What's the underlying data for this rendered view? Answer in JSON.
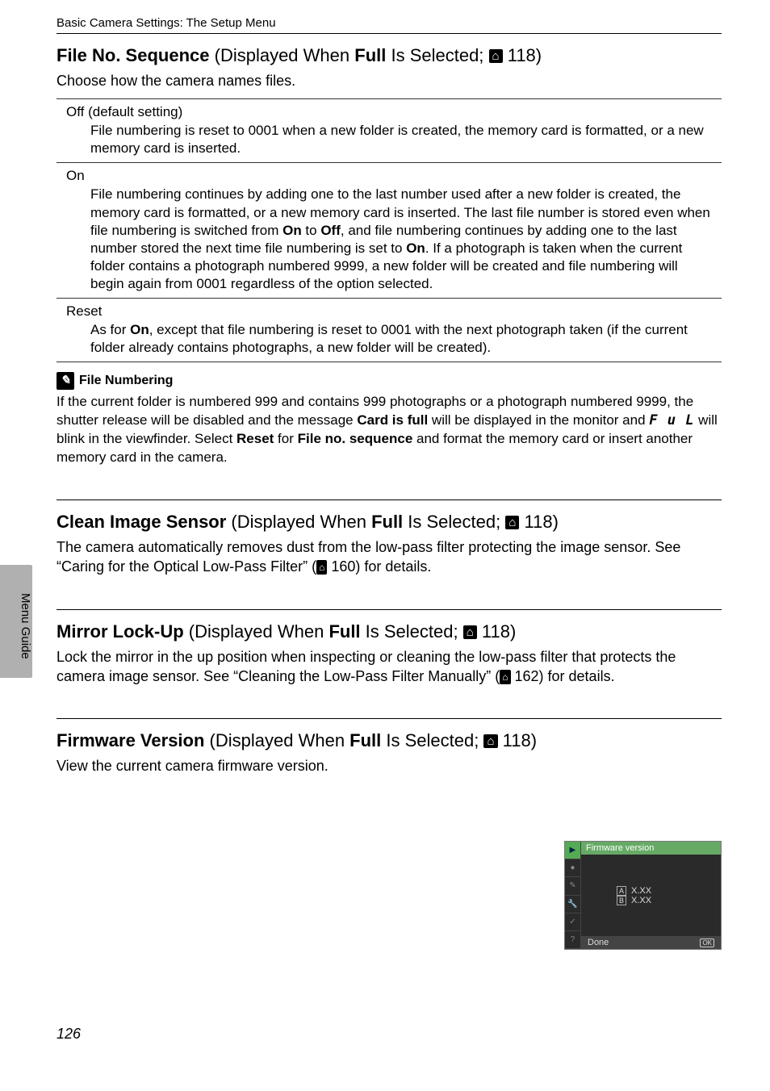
{
  "header": "Basic Camera Settings: The Setup Menu",
  "sideTab": "Menu Guide",
  "pageNumber": "126",
  "fileNoSequence": {
    "title_bold": "File No. Sequence",
    "title_rest1": " (Displayed When ",
    "title_bold2": "Full",
    "title_rest2": " Is Selected; ",
    "pageRef": " 118)",
    "desc": "Choose how the camera names files.",
    "options": [
      {
        "label": "Off (default setting)",
        "body": "File numbering is reset to 0001 when a new folder is created, the memory card is formatted, or a new memory card is inserted."
      },
      {
        "label": "On",
        "body_parts": [
          "File numbering continues by adding one to the last number used after a new folder is created, the memory card is formatted, or a new memory card is inserted. The last file number is stored even when file numbering is switched from ",
          "On",
          " to ",
          "Off",
          ", and file numbering continues by adding one to the last number stored the next time file numbering is set to ",
          "On",
          ". If a photograph is taken when the current folder contains a photograph numbered 9999, a new folder will be created and file numbering will begin again from 0001 regardless of the option selected."
        ]
      },
      {
        "label": "Reset",
        "body_parts": [
          "As for ",
          "On",
          ", except that file numbering is reset to 0001 with the next photograph taken (if the current folder already contains photographs, a new folder will be created)."
        ]
      }
    ],
    "note": {
      "heading": "File Numbering",
      "body_parts": [
        "If the current folder is numbered 999 and contains 999 photographs or a photograph numbered 9999, the shutter release will be disabled and the message ",
        "Card is full",
        " will be displayed in the monitor and ",
        " will blink in the viewfinder. Select ",
        "Reset",
        " for ",
        "File no. sequence",
        " and format the memory card or insert another memory card in the camera."
      ]
    }
  },
  "cleanImageSensor": {
    "title_bold": "Clean Image Sensor",
    "title_rest1": " (Displayed When ",
    "title_bold2": "Full",
    "title_rest2": " Is Selected; ",
    "pageRef": " 118)",
    "desc_parts": [
      "The camera automatically removes dust from the low-pass filter protecting the image sensor. See “Caring for the Optical Low-Pass Filter” (",
      " 160) for details."
    ]
  },
  "mirrorLockUp": {
    "title_bold": "Mirror Lock-Up",
    "title_rest1": " (Displayed When ",
    "title_bold2": "Full",
    "title_rest2": " Is Selected; ",
    "pageRef": " 118)",
    "desc_parts": [
      "Lock the mirror in the up position when inspecting or cleaning the low-pass filter that protects the camera image sensor. See “Cleaning the Low-Pass Filter Manually” (",
      " 162) for details."
    ]
  },
  "firmwareVersion": {
    "title_bold": "Firmware Version",
    "title_rest1": " (Displayed When ",
    "title_bold2": "Full",
    "title_rest2": " Is Selected; ",
    "pageRef": " 118)",
    "desc": "View the current camera firmware version.",
    "screen": {
      "title": "Firmware version",
      "lineA": "X.XX",
      "lineB": "X.XX",
      "done": "Done",
      "ok": "OK"
    }
  }
}
